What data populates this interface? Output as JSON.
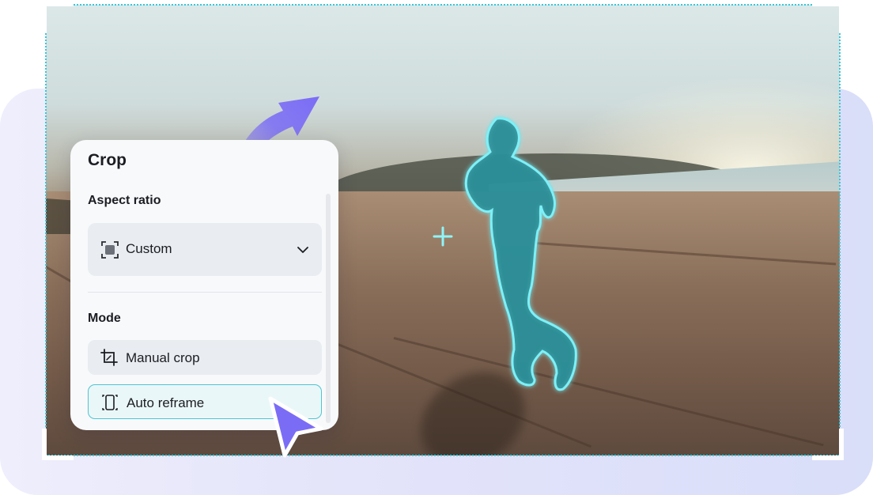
{
  "panel": {
    "title": "Crop",
    "aspect_ratio_label": "Aspect ratio",
    "aspect_ratio_value": "Custom",
    "mode_label": "Mode",
    "modes": [
      {
        "label": "Manual crop",
        "icon": "crop-icon",
        "selected": false
      },
      {
        "label": "Auto reframe",
        "icon": "reframe-icon",
        "selected": true
      }
    ]
  },
  "icons": {
    "select": "aspect-custom-icon",
    "dropdown": "chevron-down-icon",
    "cursor": "pointer-cursor-icon",
    "arrow": "curved-arrow-icon",
    "target": "crosshair-icon"
  },
  "colors": {
    "accent_purple": "#7b6cf6",
    "crop_cyan": "#36c8dc",
    "subject_highlight": "#2aa7b3",
    "panel_bg": "#f8f9fb"
  }
}
